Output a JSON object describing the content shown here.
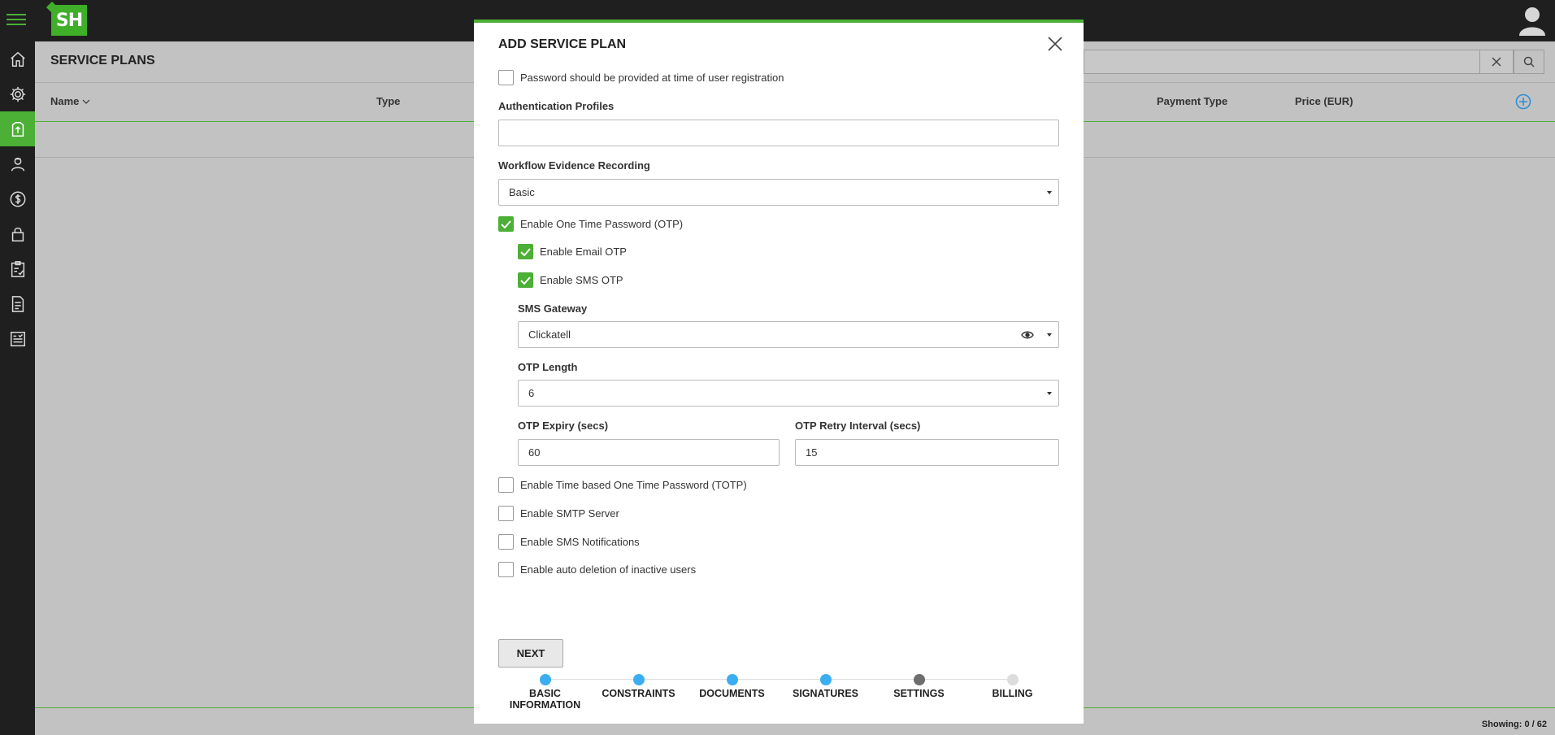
{
  "app": {
    "logo_text": "SH",
    "brand_color": "#4caf36"
  },
  "sidebar": {
    "items": [
      {
        "icon": "home-icon",
        "active": false
      },
      {
        "icon": "gear-icon",
        "active": false
      },
      {
        "icon": "service-plan-icon",
        "active": true
      },
      {
        "icon": "users-icon",
        "active": false
      },
      {
        "icon": "dollar-icon",
        "active": false
      },
      {
        "icon": "lock-icon",
        "active": false
      },
      {
        "icon": "clipboard-icon",
        "active": false
      },
      {
        "icon": "document-icon",
        "active": false
      },
      {
        "icon": "report-icon",
        "active": false
      }
    ]
  },
  "page": {
    "title": "SERVICE PLANS",
    "search_value": "",
    "columns": {
      "name": "Name",
      "type": "Type",
      "payment_type": "Payment Type",
      "price": "Price (EUR)"
    },
    "showing": "Showing: 0 / 62"
  },
  "modal": {
    "title": "ADD SERVICE PLAN",
    "password_at_registration": {
      "label": "Password should be provided at time of user registration",
      "checked": false
    },
    "auth_profiles": {
      "label": "Authentication Profiles",
      "value": ""
    },
    "workflow_evidence": {
      "label": "Workflow Evidence Recording",
      "value": "Basic"
    },
    "enable_otp": {
      "label": "Enable One Time Password (OTP)",
      "checked": true
    },
    "enable_email_otp": {
      "label": "Enable Email OTP",
      "checked": true
    },
    "enable_sms_otp": {
      "label": "Enable SMS OTP",
      "checked": true
    },
    "sms_gateway": {
      "label": "SMS Gateway",
      "value": "Clickatell"
    },
    "otp_length": {
      "label": "OTP Length",
      "value": "6"
    },
    "otp_expiry": {
      "label": "OTP Expiry (secs)",
      "value": "60"
    },
    "otp_retry": {
      "label": "OTP Retry Interval (secs)",
      "value": "15"
    },
    "enable_totp": {
      "label": "Enable Time based One Time Password (TOTP)",
      "checked": false
    },
    "enable_smtp": {
      "label": "Enable SMTP Server",
      "checked": false
    },
    "enable_sms_notifications": {
      "label": "Enable SMS Notifications",
      "checked": false
    },
    "enable_auto_deletion": {
      "label": "Enable auto deletion of inactive users",
      "checked": false
    },
    "next_label": "NEXT",
    "steps": [
      {
        "line1": "BASIC",
        "line2": "INFORMATION",
        "state": "done",
        "color": "#3aaef0"
      },
      {
        "line1": "CONSTRAINTS",
        "line2": "",
        "state": "done",
        "color": "#3aaef0"
      },
      {
        "line1": "DOCUMENTS",
        "line2": "",
        "state": "done",
        "color": "#3aaef0"
      },
      {
        "line1": "SIGNATURES",
        "line2": "",
        "state": "done",
        "color": "#3aaef0"
      },
      {
        "line1": "SETTINGS",
        "line2": "",
        "state": "current",
        "color": "#6e6e6e"
      },
      {
        "line1": "BILLING",
        "line2": "",
        "state": "pending",
        "color": "#dcdcdc"
      }
    ]
  }
}
